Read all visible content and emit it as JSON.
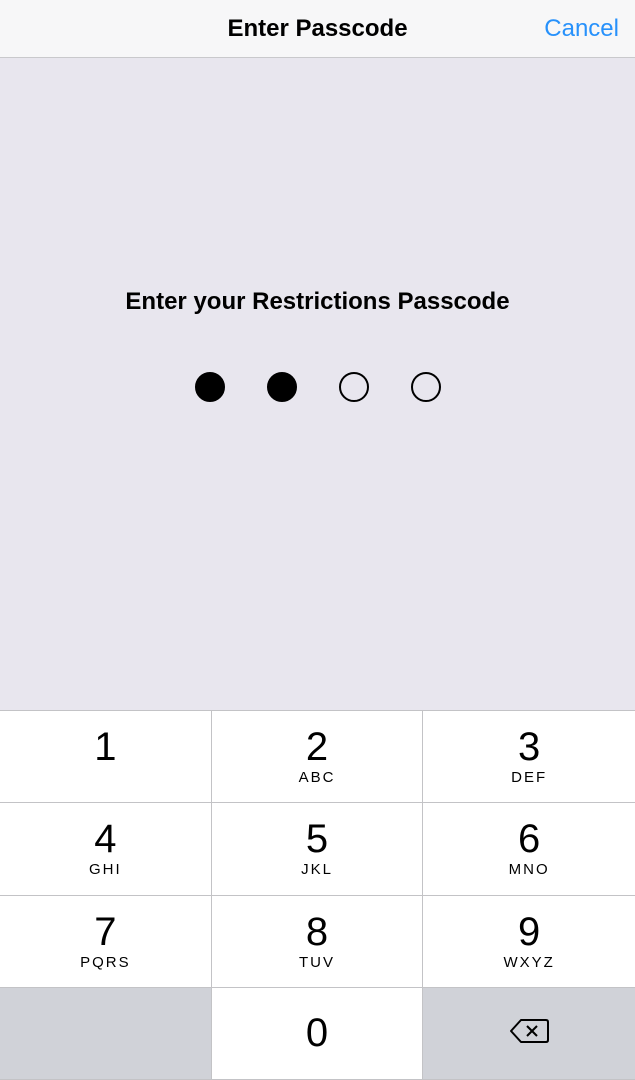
{
  "header": {
    "title": "Enter Passcode",
    "cancel_label": "Cancel"
  },
  "prompt": {
    "text": "Enter your Restrictions Passcode",
    "total_digits": 4,
    "entered_digits": 2
  },
  "keypad": {
    "keys": [
      {
        "digit": "1",
        "letters": ""
      },
      {
        "digit": "2",
        "letters": "ABC"
      },
      {
        "digit": "3",
        "letters": "DEF"
      },
      {
        "digit": "4",
        "letters": "GHI"
      },
      {
        "digit": "5",
        "letters": "JKL"
      },
      {
        "digit": "6",
        "letters": "MNO"
      },
      {
        "digit": "7",
        "letters": "PQRS"
      },
      {
        "digit": "8",
        "letters": "TUV"
      },
      {
        "digit": "9",
        "letters": "WXYZ"
      },
      {
        "digit": "0",
        "letters": ""
      }
    ],
    "delete_icon": "backspace-icon"
  }
}
